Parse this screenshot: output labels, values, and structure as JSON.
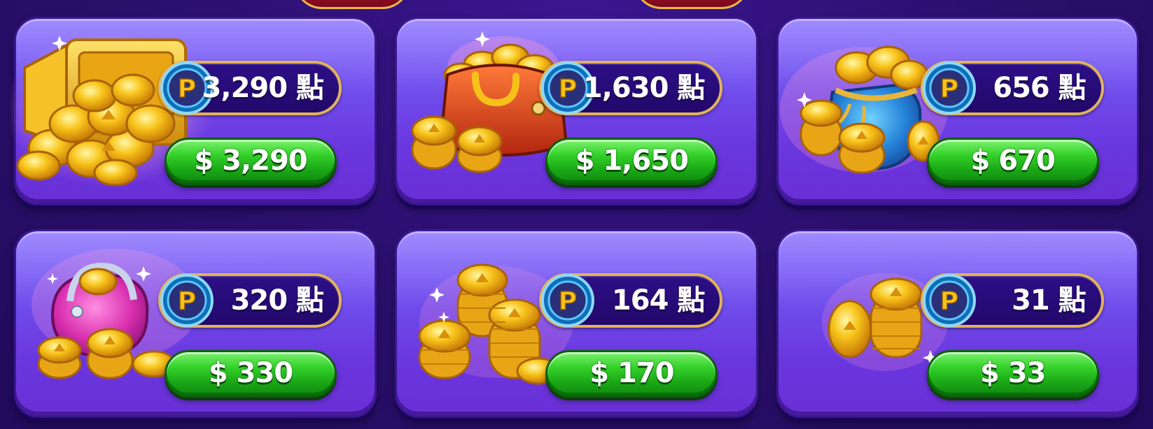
{
  "colors": {
    "background": "#2a0f6b",
    "card": "#7150ee",
    "pill_border": "#e2b35a",
    "button_green": "#1aa716",
    "coin_gold": "#f6c21a",
    "p_badge_blue": "#1fa3e8"
  },
  "p_badge_letter": "P",
  "packages": [
    {
      "points": "3,290 點",
      "price": "$ 3,290",
      "art_icon": "treasure-safe-icon"
    },
    {
      "points": "1,630 點",
      "price": "$ 1,650",
      "art_icon": "coin-purse-bag-icon"
    },
    {
      "points": "656 點",
      "price": "$ 670",
      "art_icon": "coin-sack-icon"
    },
    {
      "points": "320 點",
      "price": "$ 330",
      "art_icon": "coin-pouch-icon"
    },
    {
      "points": "164 點",
      "price": "$ 170",
      "art_icon": "coin-stacks-icon"
    },
    {
      "points": "31 點",
      "price": "$ 33",
      "art_icon": "coin-stack-small-icon"
    }
  ]
}
